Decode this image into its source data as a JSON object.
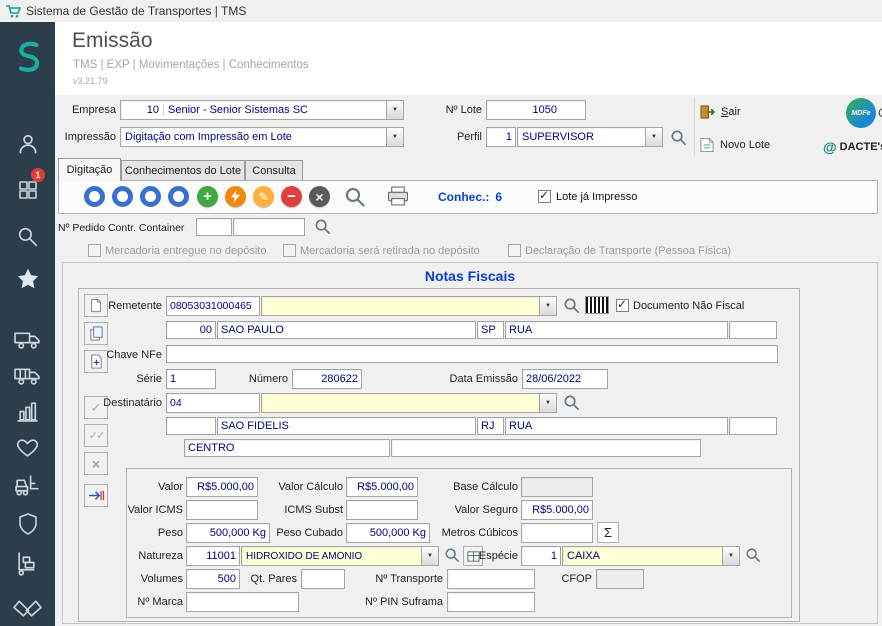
{
  "app": {
    "title": "Sistema de Gestão de Transportes | TMS"
  },
  "colors": {
    "accent_teal": "#16b1a2",
    "field_text": "#000080",
    "heading_blue": "#0a3fd1",
    "combo_yellow": "#ffffd6",
    "sidebar_bg": "#2c3d4c",
    "badge_red": "#e53935"
  },
  "sidebar": {
    "badge_count": "1",
    "icons": [
      "senior-logo",
      "user",
      "modules",
      "search",
      "favorites",
      "truck-outbound",
      "truck-inbound",
      "statistics",
      "heart",
      "forklift",
      "shield",
      "cargo-cart",
      "handshake"
    ]
  },
  "header": {
    "title": "Emissão",
    "breadcrumb": "TMS | EXP | Movimentações | Conhecimentos",
    "version": "v3.21.79"
  },
  "topbar": {
    "empresa_label": "Empresa",
    "empresa_code": "10",
    "empresa_name": "Senior - Senior Sistemas SC",
    "lote_label": "Nº Lote",
    "lote_value": "1050",
    "impressao_label": "Impressão",
    "impressao_value": "Digitação com Impressão em Lote",
    "perfil_label": "Perfil",
    "perfil_code": "1",
    "perfil_name": "SUPERVISOR",
    "sair_label": "Sair",
    "novo_lote_label": "Novo Lote",
    "mdfe_label": "MDFe",
    "truncated_label": "C",
    "dacte_at": "@",
    "dacte_label": "DACTE's"
  },
  "tabs": {
    "t1": "Digitação",
    "t2": "Conhecimentos do Lote",
    "t3": "Consulta"
  },
  "toolbar": {
    "conhec_label": "Conhec.:",
    "conhec_value": "6",
    "lote_impresso_label": "Lote já Impresso"
  },
  "pedido": {
    "label": "Nº Pedido Contr. Container"
  },
  "flags": {
    "entregue": "Mercadoria entregue no depósito",
    "retirada": "Mercadoria será retirada no depósito",
    "declaracao": "Declaração de Transporte (Pessoa Física)"
  },
  "notas": {
    "title": "Notas Fiscais",
    "remetente_label": "Remetente",
    "remetente_doc": "08053031000465",
    "doc_nao_fiscal_label": "Documento Não Fiscal",
    "rem_addr": {
      "code": "00",
      "city": "SAO PAULO",
      "uf": "SP",
      "street": "RUA"
    },
    "chave_label": "Chave NFe",
    "serie_label": "Série",
    "serie_value": "1",
    "numero_label": "Número",
    "numero_value": "280622",
    "data_label": "Data Emissão",
    "data_value": "28/06/2022",
    "destinatario_label": "Destinatário",
    "destinatario_doc": "04",
    "dest_addr": {
      "city": "SAO FIDELIS",
      "uf": "RJ",
      "street": "RUA"
    },
    "bairro_value": "CENTRO",
    "valores": {
      "valor_label": "Valor",
      "valor": "R$5.000,00",
      "valor_calculo_label": "Valor Cálculo",
      "valor_calculo": "R$5.000,00",
      "base_calculo_label": "Base Cálculo",
      "valor_icms_label": "Valor ICMS",
      "icms_subst_label": "ICMS Subst",
      "valor_seguro_label": "Valor Seguro",
      "valor_seguro": "R$5.000,00",
      "peso_label": "Peso",
      "peso": "500,000 Kg",
      "peso_cubado_label": "Peso Cubado",
      "peso_cubado": "500,000 Kg",
      "metros_label": "Metros Cúbicos",
      "natureza_label": "Natureza",
      "natureza_code": "11001",
      "natureza_desc": "HIDRÓXIDO DE AMÔNIO",
      "especie_label": "Espécie",
      "especie_code": "1",
      "especie_desc": "CAIXA",
      "volumes_label": "Volumes",
      "volumes": "500",
      "qt_pares_label": "Qt. Pares",
      "transporte_label": "Nº Transporte",
      "cfop_label": "CFOP",
      "marca_label": "Nº Marca",
      "pin_label": "Nº PIN Suframa"
    }
  }
}
